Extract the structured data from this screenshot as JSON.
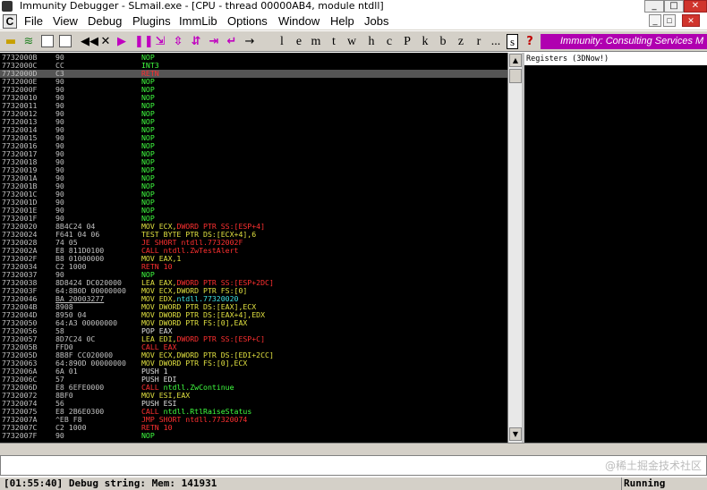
{
  "window": {
    "title": "Immunity Debugger - SLmail.exe - [CPU - thread 00000AB4, module ntdll]",
    "min_glyph": "_",
    "max_glyph": "□",
    "close_glyph": "✕"
  },
  "menu": {
    "mdi_icon": "C",
    "items": [
      "File",
      "View",
      "Debug",
      "Plugins",
      "ImmLib",
      "Options",
      "Window",
      "Help",
      "Jobs"
    ],
    "mdi_min": "_",
    "mdi_max": "□",
    "mdi_close": "✕"
  },
  "toolbar": {
    "glyphs": [
      "◀◀",
      "✕",
      "▶",
      "❚❚",
      "⇲",
      "⇳",
      "⇵",
      "⇥",
      "↵",
      "→"
    ],
    "letters": [
      "l",
      "e",
      "m",
      "t",
      "w",
      "h",
      "c",
      "P",
      "k",
      "b",
      "z",
      "r",
      "...",
      "s"
    ],
    "help": "?",
    "banner": "Immunity: Consulting Services M",
    "icons": [
      "open-folder-icon",
      "restart-icon",
      "close-process-icon",
      "run-icon",
      "pause-icon",
      "step-into-icon",
      "step-over-icon",
      "trace-into-icon",
      "trace-over-icon",
      "execute-till-return-icon",
      "go-to-icon"
    ]
  },
  "cpu": {
    "rows": [
      {
        "addr": "7732000B",
        "hex": "90",
        "ins": [
          [
            "NOP",
            "g"
          ]
        ]
      },
      {
        "addr": "7732000C",
        "hex": "CC",
        "ins": [
          [
            "INT3",
            "g"
          ]
        ]
      },
      {
        "addr": "7732000D",
        "hex": "C3",
        "ins": [
          [
            "RETN",
            "r"
          ]
        ],
        "sel": true
      },
      {
        "addr": "7732000E",
        "hex": "90",
        "ins": [
          [
            "NOP",
            "g"
          ]
        ]
      },
      {
        "addr": "7732000F",
        "hex": "90",
        "ins": [
          [
            "NOP",
            "g"
          ]
        ]
      },
      {
        "addr": "77320010",
        "hex": "90",
        "ins": [
          [
            "NOP",
            "g"
          ]
        ]
      },
      {
        "addr": "77320011",
        "hex": "90",
        "ins": [
          [
            "NOP",
            "g"
          ]
        ]
      },
      {
        "addr": "77320012",
        "hex": "90",
        "ins": [
          [
            "NOP",
            "g"
          ]
        ]
      },
      {
        "addr": "77320013",
        "hex": "90",
        "ins": [
          [
            "NOP",
            "g"
          ]
        ]
      },
      {
        "addr": "77320014",
        "hex": "90",
        "ins": [
          [
            "NOP",
            "g"
          ]
        ]
      },
      {
        "addr": "77320015",
        "hex": "90",
        "ins": [
          [
            "NOP",
            "g"
          ]
        ]
      },
      {
        "addr": "77320016",
        "hex": "90",
        "ins": [
          [
            "NOP",
            "g"
          ]
        ]
      },
      {
        "addr": "77320017",
        "hex": "90",
        "ins": [
          [
            "NOP",
            "g"
          ]
        ]
      },
      {
        "addr": "77320018",
        "hex": "90",
        "ins": [
          [
            "NOP",
            "g"
          ]
        ]
      },
      {
        "addr": "77320019",
        "hex": "90",
        "ins": [
          [
            "NOP",
            "g"
          ]
        ]
      },
      {
        "addr": "7732001A",
        "hex": "90",
        "ins": [
          [
            "NOP",
            "g"
          ]
        ]
      },
      {
        "addr": "7732001B",
        "hex": "90",
        "ins": [
          [
            "NOP",
            "g"
          ]
        ]
      },
      {
        "addr": "7732001C",
        "hex": "90",
        "ins": [
          [
            "NOP",
            "g"
          ]
        ]
      },
      {
        "addr": "7732001D",
        "hex": "90",
        "ins": [
          [
            "NOP",
            "g"
          ]
        ]
      },
      {
        "addr": "7732001E",
        "hex": "90",
        "ins": [
          [
            "NOP",
            "g"
          ]
        ]
      },
      {
        "addr": "7732001F",
        "hex": "90",
        "ins": [
          [
            "NOP",
            "g"
          ]
        ]
      },
      {
        "addr": "77320020",
        "hex": "8B4C24 04",
        "ins": [
          [
            "MOV ECX,",
            "y"
          ],
          [
            "DWORD PTR SS:[ESP+4]",
            "r"
          ]
        ]
      },
      {
        "addr": "77320024",
        "hex": "F641 04 06",
        "ins": [
          [
            "TEST BYTE PTR DS:[ECX+4],6",
            "y"
          ]
        ]
      },
      {
        "addr": "77320028",
        "hex": "74 05",
        "ins": [
          [
            "JE SHORT ntdll.7732002F",
            "r"
          ]
        ]
      },
      {
        "addr": "7732002A",
        "hex": "E8 811D0100",
        "ins": [
          [
            "CALL ntdll.ZwTestAlert",
            "r"
          ]
        ]
      },
      {
        "addr": "7732002F",
        "hex": "B8 01000000",
        "ins": [
          [
            "MOV EAX,1",
            "y"
          ]
        ]
      },
      {
        "addr": "77320034",
        "hex": "C2 1000",
        "ins": [
          [
            "RETN 10",
            "r"
          ]
        ]
      },
      {
        "addr": "77320037",
        "hex": "90",
        "ins": [
          [
            "NOP",
            "g"
          ]
        ]
      },
      {
        "addr": "77320038",
        "hex": "8D8424 DC020000",
        "ins": [
          [
            "LEA EAX,",
            "y"
          ],
          [
            "DWORD PTR SS:[ESP+2DC]",
            "r"
          ]
        ]
      },
      {
        "addr": "7732003F",
        "hex": "64:8B0D 00000000",
        "ins": [
          [
            "MOV ECX,DWORD PTR FS:[0]",
            "y"
          ]
        ]
      },
      {
        "addr": "77320046",
        "hex": "BA 20003277",
        "hexu": true,
        "ins": [
          [
            "MOV EDX,",
            "y"
          ],
          [
            "ntdll.77320020",
            "c"
          ]
        ]
      },
      {
        "addr": "7732004B",
        "hex": "8908",
        "ins": [
          [
            "MOV DWORD PTR DS:[EAX],ECX",
            "y"
          ]
        ]
      },
      {
        "addr": "7732004D",
        "hex": "8950 04",
        "ins": [
          [
            "MOV DWORD PTR DS:[EAX+4],EDX",
            "y"
          ]
        ]
      },
      {
        "addr": "77320050",
        "hex": "64:A3 00000000",
        "ins": [
          [
            "MOV DWORD PTR FS:[0],EAX",
            "y"
          ]
        ]
      },
      {
        "addr": "77320056",
        "hex": "58",
        "ins": [
          [
            "POP EAX",
            "w"
          ]
        ]
      },
      {
        "addr": "77320057",
        "hex": "8D7C24 0C",
        "ins": [
          [
            "LEA EDI,",
            "y"
          ],
          [
            "DWORD PTR SS:[ESP+C]",
            "r"
          ]
        ]
      },
      {
        "addr": "7732005B",
        "hex": "FFD0",
        "ins": [
          [
            "CALL EAX",
            "r"
          ]
        ]
      },
      {
        "addr": "7732005D",
        "hex": "8B8F CC020000",
        "ins": [
          [
            "MOV ECX,DWORD PTR DS:[EDI+2CC]",
            "y"
          ]
        ]
      },
      {
        "addr": "77320063",
        "hex": "64:890D 00000000",
        "ins": [
          [
            "MOV DWORD PTR FS:[0],ECX",
            "y"
          ]
        ]
      },
      {
        "addr": "7732006A",
        "hex": "6A 01",
        "ins": [
          [
            "PUSH 1",
            "w"
          ]
        ]
      },
      {
        "addr": "7732006C",
        "hex": "57",
        "ins": [
          [
            "PUSH EDI",
            "w"
          ]
        ]
      },
      {
        "addr": "7732006D",
        "hex": "E8 6EFE0000",
        "ins": [
          [
            "CALL ",
            "r"
          ],
          [
            "ntdll.ZwContinue",
            "g"
          ]
        ]
      },
      {
        "addr": "77320072",
        "hex": "8BF0",
        "ins": [
          [
            "MOV ESI,EAX",
            "y"
          ]
        ]
      },
      {
        "addr": "77320074",
        "hex": "56",
        "ins": [
          [
            "PUSH ESI",
            "w"
          ]
        ]
      },
      {
        "addr": "77320075",
        "hex": "E8 2B6E0300",
        "ins": [
          [
            "CALL ",
            "r"
          ],
          [
            "ntdll.RtlRaiseStatus",
            "g"
          ]
        ]
      },
      {
        "addr": "7732007A",
        "hex": "^EB F8",
        "ins": [
          [
            "JMP SHORT ntdll.77320074",
            "r"
          ]
        ]
      },
      {
        "addr": "7732007C",
        "hex": "C2 1000",
        "ins": [
          [
            "RETN 10",
            "r"
          ]
        ]
      },
      {
        "addr": "7732007F",
        "hex": "90",
        "ins": [
          [
            "NOP",
            "g"
          ]
        ]
      }
    ]
  },
  "scroll": {
    "up": "▲",
    "down": "▼"
  },
  "registers": {
    "header": "Registers (3DNow!)"
  },
  "command": {
    "value": ""
  },
  "watermark": "@稀土掘金技术社区",
  "status": {
    "message": "[01:55:40] Debug string: Mem: 141931",
    "state": "Running"
  },
  "colors": {
    "banner": "#b000b0",
    "pane_bg": "#000000",
    "nop_green": "#40ff40",
    "mov_yellow": "#e0e040",
    "call_red": "#ff3030"
  }
}
